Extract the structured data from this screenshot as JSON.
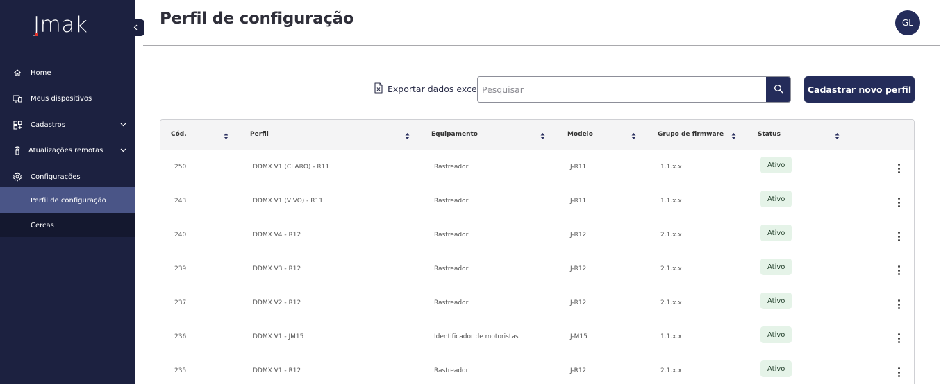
{
  "app": {
    "logo": "Jmak",
    "colors": {
      "sidebar": "#1c2140",
      "accent": "#242c5a",
      "active_item": "#4a5587",
      "logo_accent": "#e0312a",
      "status_bg": "#e5f3e8"
    }
  },
  "sidebar": {
    "collapse_icon": "chevron-left-icon",
    "items": [
      {
        "label": "Home",
        "icon": "home-icon"
      },
      {
        "label": "Meus dispositivos",
        "icon": "devices-icon"
      },
      {
        "label": "Cadastros",
        "icon": "grid-plus-icon",
        "chevron": "chevron-down-icon"
      },
      {
        "label": "Atualizações remotas",
        "icon": "remote-update-icon",
        "chevron": "chevron-down-icon"
      },
      {
        "label": "Configurações",
        "icon": "gear-icon"
      }
    ],
    "sub_items": [
      {
        "label": "Perfil de configuração",
        "active": true
      },
      {
        "label": "Cercas",
        "active": false
      }
    ]
  },
  "header": {
    "title": "Perfil de configuração",
    "avatar": "GL"
  },
  "toolbar": {
    "export_label": "Exportar dados excel",
    "export_icon": "excel-file-icon",
    "search_placeholder": "Pesquisar",
    "search_icon": "search-icon",
    "new_button": "Cadastrar novo perfil"
  },
  "table": {
    "columns": [
      "Cód.",
      "Perfil",
      "Equipamento",
      "Modelo",
      "Grupo de firmware",
      "Status"
    ],
    "rows": [
      {
        "code": "250",
        "profile": "DDMX V1 (CLARO) - R11",
        "equipment": "Rastreador",
        "model": "J-R11",
        "firmware": "1.1.x.x",
        "status": "Ativo"
      },
      {
        "code": "243",
        "profile": "DDMX V1 (VIVO) - R11",
        "equipment": "Rastreador",
        "model": "J-R11",
        "firmware": "1.1.x.x",
        "status": "Ativo"
      },
      {
        "code": "240",
        "profile": "DDMX V4 - R12",
        "equipment": "Rastreador",
        "model": "J-R12",
        "firmware": "2.1.x.x",
        "status": "Ativo"
      },
      {
        "code": "239",
        "profile": "DDMX V3 - R12",
        "equipment": "Rastreador",
        "model": "J-R12",
        "firmware": "2.1.x.x",
        "status": "Ativo"
      },
      {
        "code": "237",
        "profile": "DDMX V2 - R12",
        "equipment": "Rastreador",
        "model": "J-R12",
        "firmware": "2.1.x.x",
        "status": "Ativo"
      },
      {
        "code": "236",
        "profile": "DDMX V1 - JM15",
        "equipment": "Identificador de motoristas",
        "model": "J-M15",
        "firmware": "1.1.x.x",
        "status": "Ativo"
      },
      {
        "code": "235",
        "profile": "DDMX V1 - R12",
        "equipment": "Rastreador",
        "model": "J-R12",
        "firmware": "2.1.x.x",
        "status": "Ativo"
      }
    ]
  }
}
